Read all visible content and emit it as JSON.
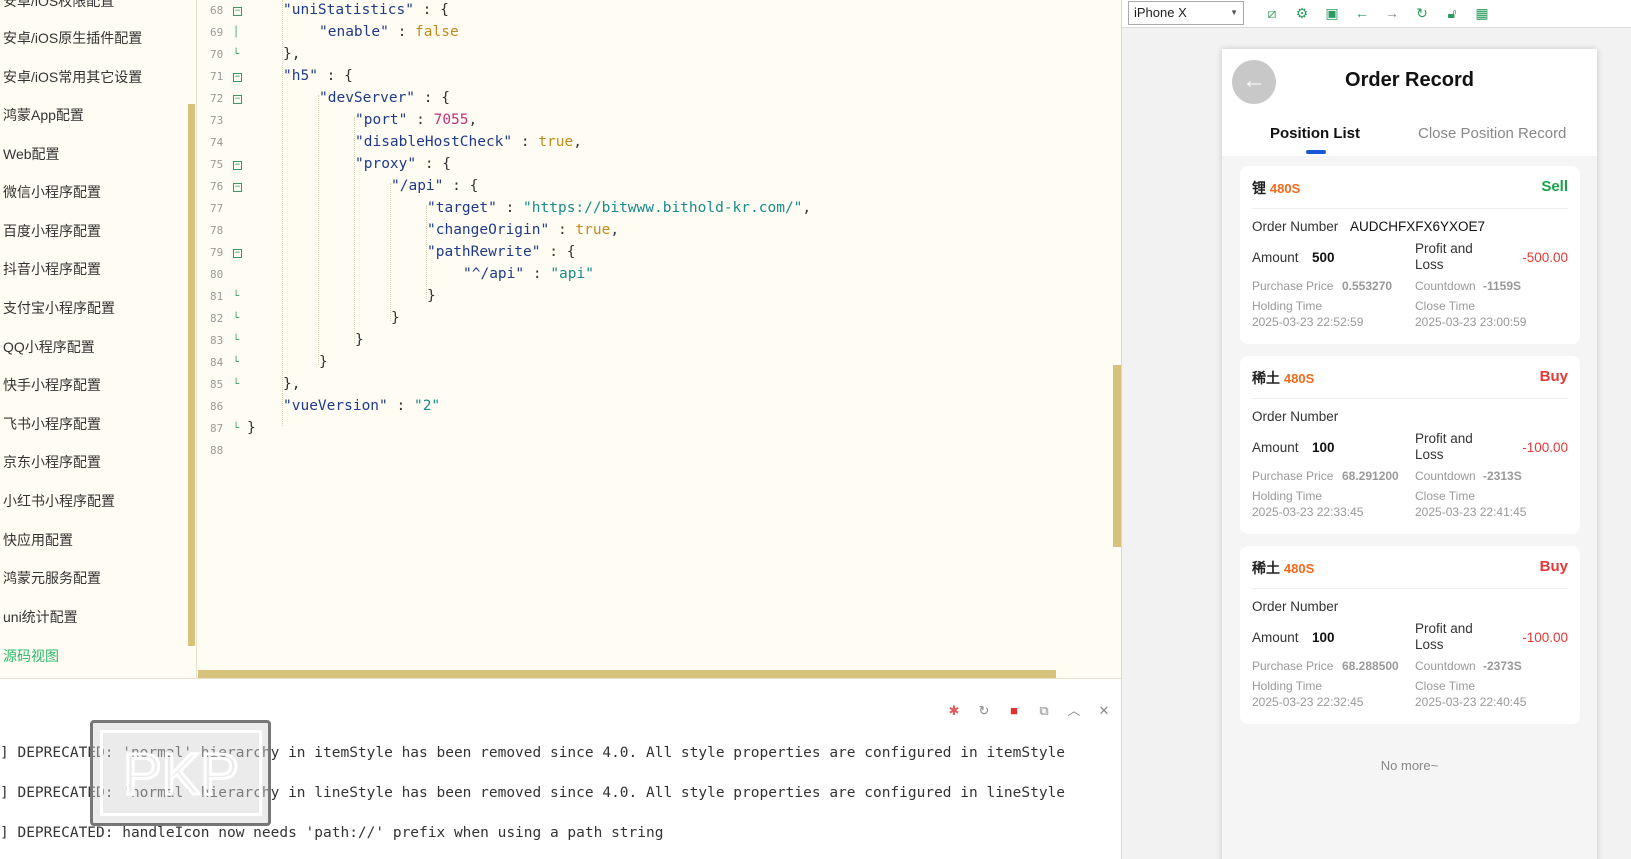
{
  "sidebar": {
    "items": [
      {
        "label": "安卓/iOS权限配置"
      },
      {
        "label": "安卓/iOS原生插件配置"
      },
      {
        "label": "安卓/iOS常用其它设置"
      },
      {
        "label": "鸿蒙App配置"
      },
      {
        "label": "Web配置"
      },
      {
        "label": "微信小程序配置"
      },
      {
        "label": "百度小程序配置"
      },
      {
        "label": "抖音小程序配置"
      },
      {
        "label": "支付宝小程序配置"
      },
      {
        "label": "QQ小程序配置"
      },
      {
        "label": "快手小程序配置"
      },
      {
        "label": "飞书小程序配置"
      },
      {
        "label": "京东小程序配置"
      },
      {
        "label": "小红书小程序配置"
      },
      {
        "label": "快应用配置"
      },
      {
        "label": "鸿蒙元服务配置"
      },
      {
        "label": "uni统计配置"
      },
      {
        "label": "源码视图"
      }
    ]
  },
  "editor": {
    "line_numbers": [
      "68",
      "69",
      "70",
      "71",
      "72",
      "73",
      "74",
      "75",
      "76",
      "77",
      "78",
      "79",
      "80",
      "81",
      "82",
      "83",
      "84",
      "85",
      "86",
      "87",
      "88"
    ],
    "code": {
      "k_unistatistics": "\"uniStatistics\"",
      "k_enable": "\"enable\"",
      "v_false": "false",
      "k_h5": "\"h5\"",
      "k_devserver": "\"devServer\"",
      "k_port": "\"port\"",
      "v_port": "7055",
      "k_disablehostcheck": "\"disableHostCheck\"",
      "v_true1": "true",
      "k_proxy": "\"proxy\"",
      "k_api": "\"/api\"",
      "k_target": "\"target\"",
      "v_target": "\"https://bitwww.bithold-kr.com/\"",
      "k_changeorigin": "\"changeOrigin\"",
      "v_true2": "true",
      "k_pathrewrite": "\"pathRewrite\"",
      "k_rewrite_from": "\"^/api\"",
      "v_rewrite_to": "\"api\"",
      "k_vueversion": "\"vueVersion\"",
      "v_vueversion": "\"2\""
    }
  },
  "console": {
    "lines": [
      "] DEPRECATED: 'normal' hierarchy in itemStyle has been removed since 4.0. All style properties are configured in itemStyle",
      "] DEPRECATED: 'normal' hierarchy in lineStyle has been removed since 4.0. All style properties are configured in lineStyle",
      "] DEPRECATED: handleIcon now needs 'path://' prefix when using a path string"
    ],
    "toolbar_icons": [
      "bug-icon",
      "restart-icon",
      "stop-icon",
      "open-external-icon",
      "collapse-up-icon",
      "clear-icon"
    ]
  },
  "preview": {
    "device": "iPhone X",
    "toolbar_icons": [
      "screenshot-icon",
      "settings-icon",
      "devtools-icon",
      "back-arrow-icon",
      "forward-arrow-icon",
      "refresh-icon",
      "unlock-icon",
      "qrcode-icon"
    ],
    "page": {
      "title": "Order Record",
      "tabs": [
        {
          "label": "Position List"
        },
        {
          "label": "Close Position Record"
        }
      ],
      "labels": {
        "order_number": "Order Number",
        "amount": "Amount",
        "pnl": "Profit and Loss",
        "purchase_price": "Purchase Price",
        "countdown": "Countdown",
        "holding_time": "Holding Time",
        "close_time": "Close Time"
      },
      "orders": [
        {
          "asset": "锂",
          "duration": "480S",
          "direction": "Sell",
          "direction_color": "#19a24a",
          "order_number": "AUDCHFXFX6YXOE7",
          "amount": "500",
          "pnl": "-500.00",
          "purchase_price": "0.553270",
          "countdown": "-1159S",
          "holding_time": "2025-03-23 22:52:59",
          "close_time": "2025-03-23 23:00:59"
        },
        {
          "asset": "稀土",
          "duration": "480S",
          "direction": "Buy",
          "direction_color": "#e53935",
          "order_number": "",
          "amount": "100",
          "pnl": "-100.00",
          "purchase_price": "68.291200",
          "countdown": "-2313S",
          "holding_time": "2025-03-23 22:33:45",
          "close_time": "2025-03-23 22:41:45"
        },
        {
          "asset": "稀土",
          "duration": "480S",
          "direction": "Buy",
          "direction_color": "#e53935",
          "order_number": "",
          "amount": "100",
          "pnl": "-100.00",
          "purchase_price": "68.288500",
          "countdown": "-2373S",
          "holding_time": "2025-03-23 22:32:45",
          "close_time": "2025-03-23 22:40:45"
        }
      ],
      "footer": "No more~"
    }
  },
  "watermark": {
    "text": "PKP"
  }
}
